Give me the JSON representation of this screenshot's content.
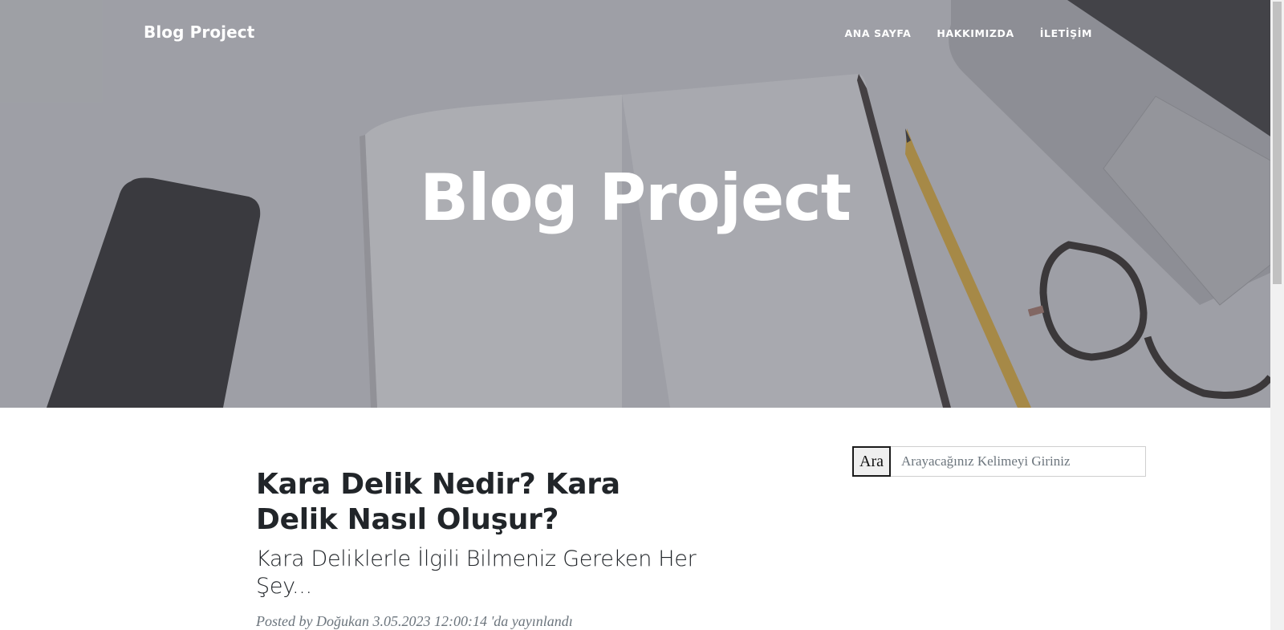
{
  "navbar": {
    "brand": "Blog Project",
    "links": [
      "ANA SAYFA",
      "HAKKIMIZDA",
      "İLETİŞİM"
    ]
  },
  "hero": {
    "title": "Blog Project"
  },
  "search": {
    "button_label": "Ara",
    "placeholder": "Arayacağınız Kelimeyi Giriniz"
  },
  "post": {
    "title": "Kara Delik Nedir? Kara Delik Nasıl Oluşur?",
    "subtitle": "Kara Deliklerle İlgili Bilmeniz Gereken Her Şey...",
    "meta": "Posted by Doğukan 3.05.2023 12:00:14 'da yayınlandı"
  },
  "colors": {
    "heading": "#212529",
    "muted": "#6c757d",
    "hero_overlay": "#50525a"
  }
}
